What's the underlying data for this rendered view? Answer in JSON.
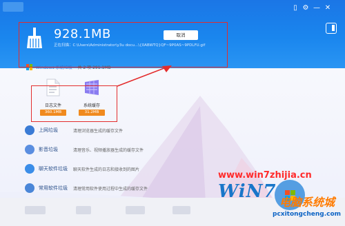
{
  "header": {
    "size": "928.1MB",
    "scanning": "正在扫描：C:\\Users\\Administrator\\y3u docu...\\{0ABWTQ}QF~9P0AS~9PDLFU.gif",
    "cancel_label": "取消",
    "window_controls": [
      "▯",
      "⚙",
      "—",
      "✕"
    ]
  },
  "category_line": {
    "prefix": "Windows 系统垃圾",
    "summary": "共 2 项 291.1MB"
  },
  "cards": [
    {
      "label": "日志文件",
      "size": "360.1MB"
    },
    {
      "label": "系统缓存",
      "size": "31.2MB"
    }
  ],
  "list": [
    {
      "name": "上网垃圾",
      "desc": "清理浏览器生成的缓存文件",
      "color": "#3a7bd5"
    },
    {
      "name": "影音垃圾",
      "desc": "清理音乐、视频播放器生成的缓存文件",
      "color": "#5a8ee0"
    },
    {
      "name": "聊天软件垃圾",
      "desc": "聊天软件生成的日志和接收到的图片",
      "color": "#3b8de8"
    },
    {
      "name": "常用软件垃圾",
      "desc": "清理常用软件使用过程中生成的缓存文件",
      "color": "#4a86d8"
    }
  ],
  "watermark": {
    "url": "www.win7zhijia.cn",
    "brand": "WiN7",
    "cn": "电脑系统城",
    "url2": "pcxitongcheng.com"
  }
}
